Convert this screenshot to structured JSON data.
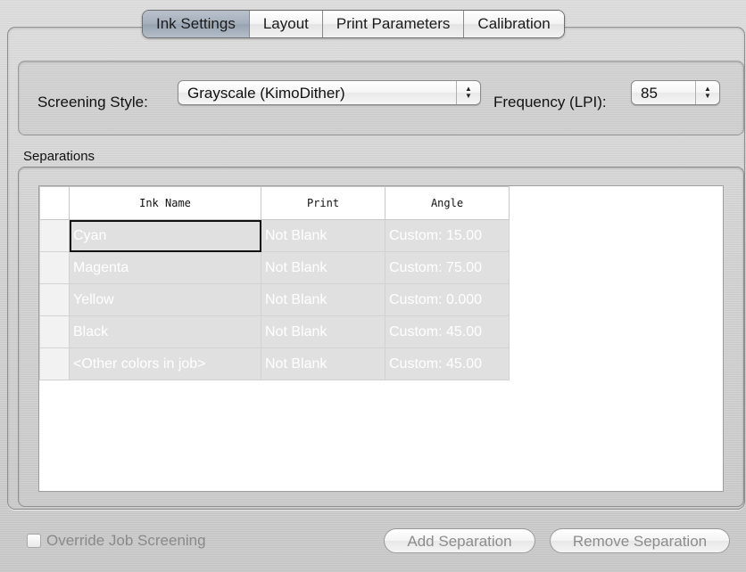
{
  "tabs": [
    "Ink Settings",
    "Layout",
    "Print Parameters",
    "Calibration"
  ],
  "active_tab": "Ink Settings",
  "screening": {
    "style_label": "Screening Style:",
    "style_value": "Grayscale (KimoDither)",
    "frequency_label": "Frequency (LPI):",
    "frequency_value": "85"
  },
  "separations": {
    "label": "Separations",
    "columns": [
      "Ink Name",
      "Print",
      "Angle"
    ],
    "rows": [
      {
        "ink": "Cyan",
        "print": "Not Blank",
        "angle": "Custom: 15.00"
      },
      {
        "ink": "Magenta",
        "print": "Not Blank",
        "angle": "Custom: 75.00"
      },
      {
        "ink": "Yellow",
        "print": "Not Blank",
        "angle": "Custom: 0.000"
      },
      {
        "ink": "Black",
        "print": "Not Blank",
        "angle": "Custom: 45.00"
      },
      {
        "ink": "<Other colors in job>",
        "print": "Not Blank",
        "angle": "Custom: 45.00"
      }
    ]
  },
  "footer": {
    "override_label": "Override Job Screening",
    "override_checked": false,
    "add_label": "Add Separation",
    "remove_label": "Remove Separation"
  }
}
